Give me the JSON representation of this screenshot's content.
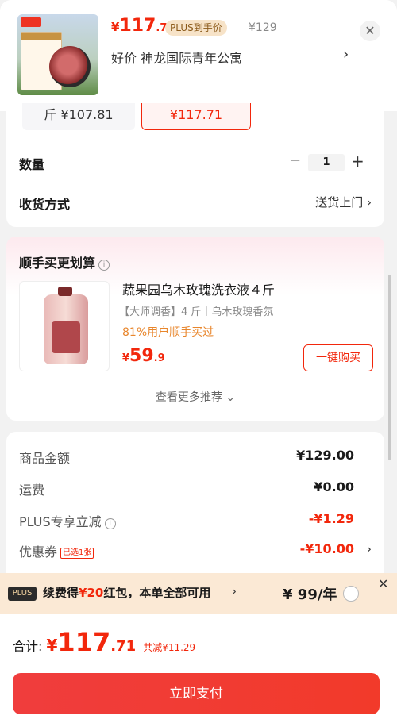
{
  "product": {
    "price_currency": "¥",
    "price_int": "117",
    "price_dec": ".71",
    "plus_tag": "PLUS到手价",
    "orig_price": "¥129",
    "address": "好价  神龙国际青年公寓"
  },
  "specs": {
    "option_a": "斤 ¥107.81",
    "option_b": "¥117.71"
  },
  "quantity": {
    "label": "数量",
    "value": "1",
    "minus": "−",
    "plus": "+"
  },
  "delivery": {
    "label": "收货方式",
    "value": "送货上门"
  },
  "recommend": {
    "title": "顺手买更划算",
    "name": "蔬果园乌木玫瑰洗衣液４斤",
    "subtitle": "【大师调香】4 斤丨乌木玫瑰香氛",
    "social": "81%用户顺手买过",
    "price_currency": "¥",
    "price_int": "59",
    "price_dec": ".9",
    "button": "一键购买",
    "more": "查看更多推荐 ⌄"
  },
  "summary": {
    "rows": [
      {
        "label": "商品金额",
        "value": "¥129.00"
      },
      {
        "label": "运费",
        "value": "¥0.00"
      },
      {
        "label": "PLUS专享立减",
        "value": "-¥1.29"
      },
      {
        "label": "优惠券",
        "value": "-¥10.00",
        "tag": "已选1张"
      }
    ]
  },
  "plus_bar": {
    "badge": "PLUS",
    "text_pre": "续费得",
    "text_hl": "¥20",
    "text_post": "红包，本单全部可用",
    "price": "¥ 99/年"
  },
  "footer": {
    "total_label": "合计:",
    "total_currency": "¥",
    "total_int": "117",
    "total_dec": ".71",
    "saved": "共减¥11.29",
    "pay_button": "立即支付"
  },
  "colors": {
    "accent": "#f2270c",
    "plus_bar_bg": "#fbe9d5",
    "social_orange": "#e8862c"
  }
}
